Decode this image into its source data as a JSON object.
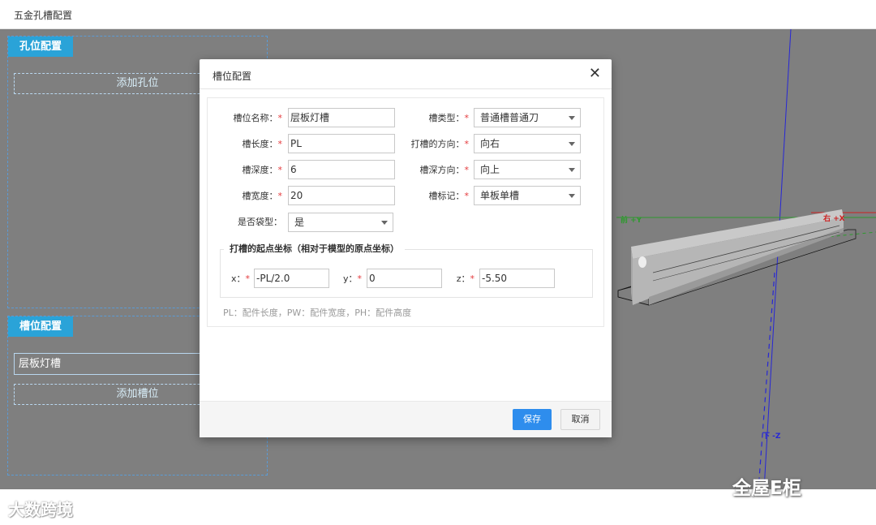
{
  "window": {
    "title": "五金孔槽配置"
  },
  "left_panel": {
    "holes": {
      "title": "孔位配置",
      "add_label": "添加孔位"
    },
    "slots": {
      "title": "槽位配置",
      "items": [
        "层板灯槽"
      ],
      "add_label": "添加槽位"
    }
  },
  "scene": {
    "axis_labels": {
      "front_y": "前 +Y",
      "right_x": "右 +X",
      "down_z": "下 -Z"
    }
  },
  "modal": {
    "title": "槽位配置",
    "close_icon": "close-icon",
    "fields": {
      "name": {
        "label": "槽位名称：",
        "value": "层板灯槽"
      },
      "length": {
        "label": "槽长度：",
        "value": "PL"
      },
      "depth": {
        "label": "槽深度：",
        "value": "6"
      },
      "width": {
        "label": "槽宽度：",
        "value": "20"
      },
      "pocket": {
        "label": "是否袋型：",
        "value": "是"
      },
      "type": {
        "label": "槽类型：",
        "value": "普通槽普通刀"
      },
      "direction": {
        "label": "打槽的方向：",
        "value": "向右"
      },
      "depth_dir": {
        "label": "槽深方向：",
        "value": "向上"
      },
      "mark": {
        "label": "槽标记：",
        "value": "单板单槽"
      }
    },
    "required_mark": "*",
    "origin": {
      "legend": "打槽的起点坐标（相对于模型的原点坐标）",
      "x": {
        "label": "x：",
        "value": "-PL/2.0"
      },
      "y": {
        "label": "y：",
        "value": "0"
      },
      "z": {
        "label": "z：",
        "value": "-5.50"
      }
    },
    "hint": "PL：配件长度，PW：配件宽度，PH：配件高度",
    "save_label": "保存",
    "cancel_label": "取消"
  },
  "watermarks": {
    "left": "大数跨境",
    "right": "全屋E柜"
  },
  "colors": {
    "accent": "#2aa3d8",
    "primary_button": "#2e8ded",
    "workspace": "#7f7f7f",
    "required": "#e4393c"
  }
}
